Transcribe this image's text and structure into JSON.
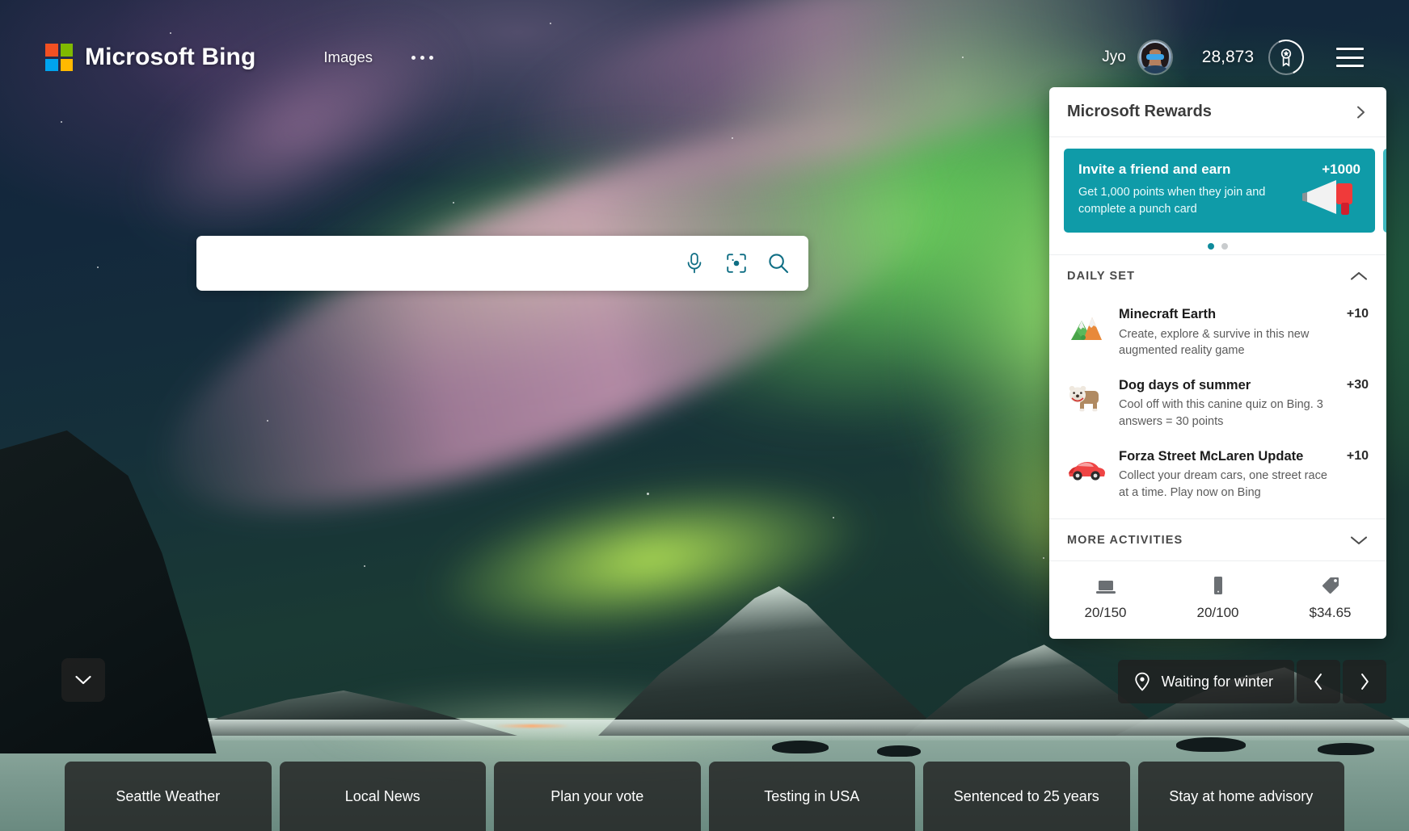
{
  "header": {
    "brand": "Microsoft Bing",
    "nav_links": [
      "Images"
    ],
    "overflow_label": "more-menu",
    "user_name": "Jyo",
    "points": "28,873",
    "logo_colors": [
      "#f25022",
      "#7fba00",
      "#00a4ef",
      "#ffb900"
    ]
  },
  "search": {
    "value": "",
    "placeholder": "",
    "icons": [
      "microphone-icon",
      "visual-search-icon",
      "search-icon"
    ],
    "icon_color": "#0f6e84"
  },
  "rewards": {
    "title": "Microsoft Rewards",
    "promo": {
      "title": "Invite a friend and earn",
      "points": "+1000",
      "description": "Get 1,000 points when they join and complete a punch card",
      "icon": "megaphone-icon",
      "bg_color": "#0f9ba8"
    },
    "carousel_dots": 2,
    "carousel_active": 0,
    "daily_set": {
      "label": "DAILY SET",
      "expanded": true,
      "items": [
        {
          "icon": "mountain-icon",
          "title": "Minecraft Earth",
          "description": "Create, explore & survive in this new augmented reality game",
          "points": "+10"
        },
        {
          "icon": "dog-icon",
          "title": "Dog days of summer",
          "description": "Cool off with this canine quiz on Bing. 3 answers = 30 points",
          "points": "+30"
        },
        {
          "icon": "car-icon",
          "title": "Forza Street McLaren Update",
          "description": "Collect your dream cars, one street race at a time. Play now on Bing",
          "points": "+10"
        }
      ]
    },
    "more_activities": {
      "label": "MORE ACTIVITIES",
      "expanded": false
    },
    "stats": [
      {
        "icon": "laptop-icon",
        "value": "20/150"
      },
      {
        "icon": "phone-icon",
        "value": "20/100"
      },
      {
        "icon": "tag-icon",
        "value": "$34.65"
      }
    ]
  },
  "image_info": {
    "caption": "Waiting for winter",
    "pin_icon": "location-pin-icon",
    "prev_label": "‹",
    "next_label": "›"
  },
  "expand_button": {
    "icon": "chevron-down-icon"
  },
  "trending": {
    "tiles": [
      "Seattle Weather",
      "Local News",
      "Plan your vote",
      "Testing in USA",
      "Sentenced to 25 years",
      "Stay at home advisory"
    ]
  }
}
